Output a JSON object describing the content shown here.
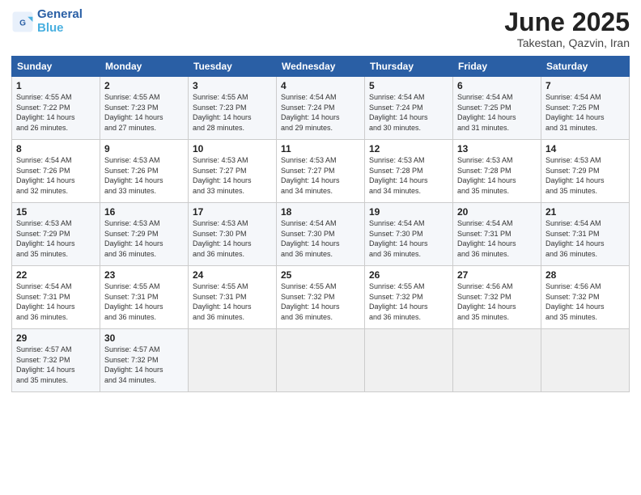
{
  "logo": {
    "line1": "General",
    "line2": "Blue"
  },
  "title": "June 2025",
  "location": "Takestan, Qazvin, Iran",
  "days_of_week": [
    "Sunday",
    "Monday",
    "Tuesday",
    "Wednesday",
    "Thursday",
    "Friday",
    "Saturday"
  ],
  "weeks": [
    [
      {
        "day": "1",
        "info": "Sunrise: 4:55 AM\nSunset: 7:22 PM\nDaylight: 14 hours\nand 26 minutes."
      },
      {
        "day": "2",
        "info": "Sunrise: 4:55 AM\nSunset: 7:23 PM\nDaylight: 14 hours\nand 27 minutes."
      },
      {
        "day": "3",
        "info": "Sunrise: 4:55 AM\nSunset: 7:23 PM\nDaylight: 14 hours\nand 28 minutes."
      },
      {
        "day": "4",
        "info": "Sunrise: 4:54 AM\nSunset: 7:24 PM\nDaylight: 14 hours\nand 29 minutes."
      },
      {
        "day": "5",
        "info": "Sunrise: 4:54 AM\nSunset: 7:24 PM\nDaylight: 14 hours\nand 30 minutes."
      },
      {
        "day": "6",
        "info": "Sunrise: 4:54 AM\nSunset: 7:25 PM\nDaylight: 14 hours\nand 31 minutes."
      },
      {
        "day": "7",
        "info": "Sunrise: 4:54 AM\nSunset: 7:25 PM\nDaylight: 14 hours\nand 31 minutes."
      }
    ],
    [
      {
        "day": "8",
        "info": "Sunrise: 4:54 AM\nSunset: 7:26 PM\nDaylight: 14 hours\nand 32 minutes."
      },
      {
        "day": "9",
        "info": "Sunrise: 4:53 AM\nSunset: 7:26 PM\nDaylight: 14 hours\nand 33 minutes."
      },
      {
        "day": "10",
        "info": "Sunrise: 4:53 AM\nSunset: 7:27 PM\nDaylight: 14 hours\nand 33 minutes."
      },
      {
        "day": "11",
        "info": "Sunrise: 4:53 AM\nSunset: 7:27 PM\nDaylight: 14 hours\nand 34 minutes."
      },
      {
        "day": "12",
        "info": "Sunrise: 4:53 AM\nSunset: 7:28 PM\nDaylight: 14 hours\nand 34 minutes."
      },
      {
        "day": "13",
        "info": "Sunrise: 4:53 AM\nSunset: 7:28 PM\nDaylight: 14 hours\nand 35 minutes."
      },
      {
        "day": "14",
        "info": "Sunrise: 4:53 AM\nSunset: 7:29 PM\nDaylight: 14 hours\nand 35 minutes."
      }
    ],
    [
      {
        "day": "15",
        "info": "Sunrise: 4:53 AM\nSunset: 7:29 PM\nDaylight: 14 hours\nand 35 minutes."
      },
      {
        "day": "16",
        "info": "Sunrise: 4:53 AM\nSunset: 7:29 PM\nDaylight: 14 hours\nand 36 minutes."
      },
      {
        "day": "17",
        "info": "Sunrise: 4:53 AM\nSunset: 7:30 PM\nDaylight: 14 hours\nand 36 minutes."
      },
      {
        "day": "18",
        "info": "Sunrise: 4:54 AM\nSunset: 7:30 PM\nDaylight: 14 hours\nand 36 minutes."
      },
      {
        "day": "19",
        "info": "Sunrise: 4:54 AM\nSunset: 7:30 PM\nDaylight: 14 hours\nand 36 minutes."
      },
      {
        "day": "20",
        "info": "Sunrise: 4:54 AM\nSunset: 7:31 PM\nDaylight: 14 hours\nand 36 minutes."
      },
      {
        "day": "21",
        "info": "Sunrise: 4:54 AM\nSunset: 7:31 PM\nDaylight: 14 hours\nand 36 minutes."
      }
    ],
    [
      {
        "day": "22",
        "info": "Sunrise: 4:54 AM\nSunset: 7:31 PM\nDaylight: 14 hours\nand 36 minutes."
      },
      {
        "day": "23",
        "info": "Sunrise: 4:55 AM\nSunset: 7:31 PM\nDaylight: 14 hours\nand 36 minutes."
      },
      {
        "day": "24",
        "info": "Sunrise: 4:55 AM\nSunset: 7:31 PM\nDaylight: 14 hours\nand 36 minutes."
      },
      {
        "day": "25",
        "info": "Sunrise: 4:55 AM\nSunset: 7:32 PM\nDaylight: 14 hours\nand 36 minutes."
      },
      {
        "day": "26",
        "info": "Sunrise: 4:55 AM\nSunset: 7:32 PM\nDaylight: 14 hours\nand 36 minutes."
      },
      {
        "day": "27",
        "info": "Sunrise: 4:56 AM\nSunset: 7:32 PM\nDaylight: 14 hours\nand 35 minutes."
      },
      {
        "day": "28",
        "info": "Sunrise: 4:56 AM\nSunset: 7:32 PM\nDaylight: 14 hours\nand 35 minutes."
      }
    ],
    [
      {
        "day": "29",
        "info": "Sunrise: 4:57 AM\nSunset: 7:32 PM\nDaylight: 14 hours\nand 35 minutes."
      },
      {
        "day": "30",
        "info": "Sunrise: 4:57 AM\nSunset: 7:32 PM\nDaylight: 14 hours\nand 34 minutes."
      },
      {
        "day": "",
        "info": ""
      },
      {
        "day": "",
        "info": ""
      },
      {
        "day": "",
        "info": ""
      },
      {
        "day": "",
        "info": ""
      },
      {
        "day": "",
        "info": ""
      }
    ]
  ]
}
